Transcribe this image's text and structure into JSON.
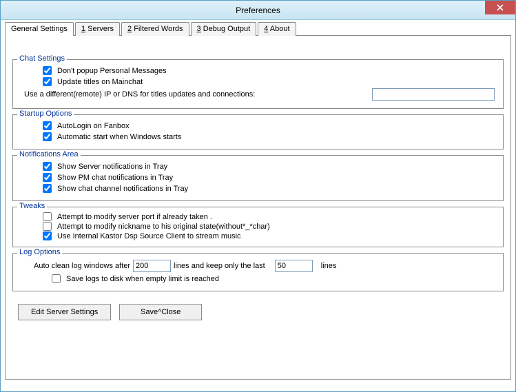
{
  "window": {
    "title": "Preferences"
  },
  "tabs": {
    "t0": "General Settings",
    "t1p": "1",
    "t1s": " Servers",
    "t2p": "2",
    "t2s": " Filtered Words",
    "t3p": "3",
    "t3s": " Debug Output",
    "t4p": "4",
    "t4s": " About"
  },
  "chat": {
    "legend": "Chat Settings",
    "c1": "Don't popup Personal Messages",
    "c2": "Update titles on Mainchat",
    "ipLabel": "Use a different(remote) IP or DNS  for titles updates and connections:",
    "ipValue": ""
  },
  "startup": {
    "legend": "Startup Options",
    "c1": "AutoLogin on Fanbox",
    "c2": "Automatic start when Windows starts"
  },
  "notif": {
    "legend": "Notifications Area",
    "c1": "Show Server notifications in Tray",
    "c2": "Show PM chat notifications in Tray",
    "c3": "Show chat channel notifications in Tray"
  },
  "tweaks": {
    "legend": "Tweaks",
    "c1": "Attempt to modify server  port if already taken .",
    "c2": "Attempt to modify nickname to his original  state(without*_*char)",
    "c3": "Use Internal Kastor Dsp Source Client to stream music"
  },
  "log": {
    "legend": "Log Options",
    "pre": "Auto clean log windows after",
    "v1": "200",
    "mid": "lines  and keep only the last",
    "v2": "50",
    "post": "lines",
    "c1": "Save logs to disk when empty limit is reached"
  },
  "buttons": {
    "editServer": "Edit Server Settings",
    "saveClose": "Save^Close"
  }
}
